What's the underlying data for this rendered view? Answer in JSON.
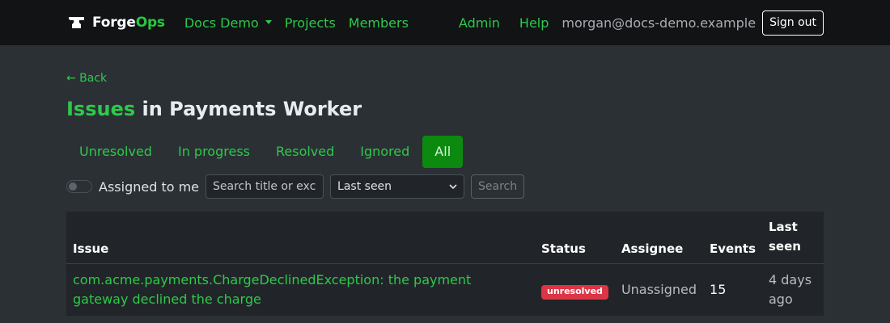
{
  "nav": {
    "brand_prefix": "Forge",
    "brand_accent": "Ops",
    "org_dropdown": "Docs Demo",
    "projects": "Projects",
    "members": "Members",
    "admin": "Admin",
    "help": "Help",
    "user_email": "morgan@docs-demo.example",
    "sign_out": "Sign out"
  },
  "back_link": "← Back",
  "page_title": {
    "highlight": "Issues",
    "rest": " in Payments Worker"
  },
  "tabs": [
    {
      "label": "Unresolved",
      "active": false
    },
    {
      "label": "In progress",
      "active": false
    },
    {
      "label": "Resolved",
      "active": false
    },
    {
      "label": "Ignored",
      "active": false
    },
    {
      "label": "All",
      "active": true
    }
  ],
  "filters": {
    "assigned_to_me_label": "Assigned to me",
    "assigned_to_me": false,
    "search_placeholder": "Search title or exce",
    "sort_selected": "Last seen",
    "search_button": "Search"
  },
  "table": {
    "headers": {
      "issue": "Issue",
      "status": "Status",
      "assignee": "Assignee",
      "events": "Events",
      "last_seen": "Last seen"
    },
    "rows": [
      {
        "issue": "com.acme.payments.ChargeDeclinedException: the payment gateway declined the charge",
        "status": "unresolved",
        "assignee": "Unassigned",
        "events": "15",
        "last_seen": "4 days ago"
      }
    ]
  },
  "colors": {
    "accent": "#2ec94a",
    "active_tab": "#0b8a0f",
    "status_unresolved": "#dc3545",
    "navbar_bg": "#111315",
    "page_bg": "#2b3035"
  }
}
